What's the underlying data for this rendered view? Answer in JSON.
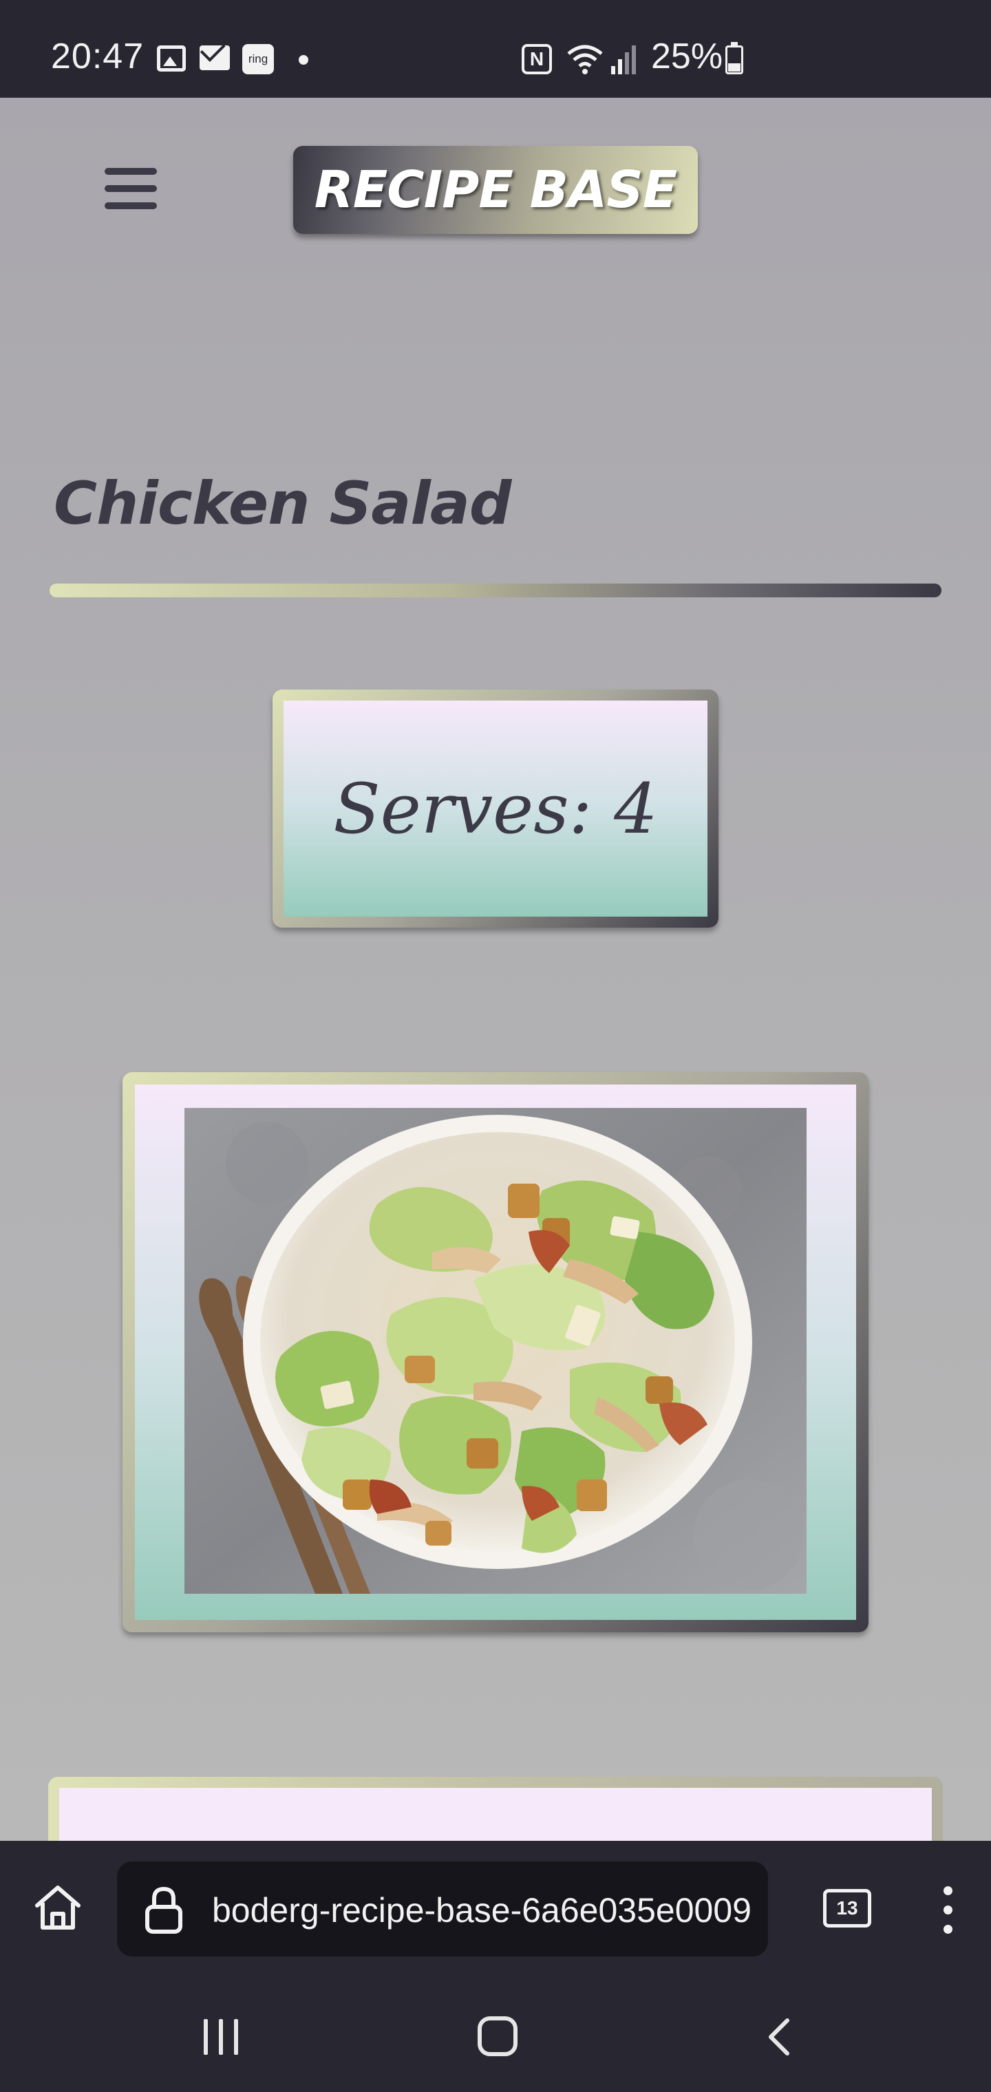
{
  "status_bar": {
    "time": "20:47",
    "notification_icons": [
      "gallery-icon",
      "mail-icon",
      "ring-icon"
    ],
    "ring_label": "ring",
    "nfc_label": "N",
    "battery_percent": "25%"
  },
  "header": {
    "menu_icon": "hamburger-menu-icon",
    "brand": "RECIPE BASE"
  },
  "recipe": {
    "title": "Chicken Salad",
    "serves": "Serves: 4",
    "image_subject": "chicken caesar salad in a white bowl with wooden servers"
  },
  "browser": {
    "url": "boderg-recipe-base-6a6e035e0009",
    "tab_count": "13"
  },
  "colors": {
    "page_bg": "#a8a6ab",
    "system_bar_bg": "#282630",
    "text_dark": "#3d3a48",
    "accent_light": "#dfe2b6",
    "accent_mint": "#96cbbc",
    "card_inner_top": "#f6e9fa"
  }
}
